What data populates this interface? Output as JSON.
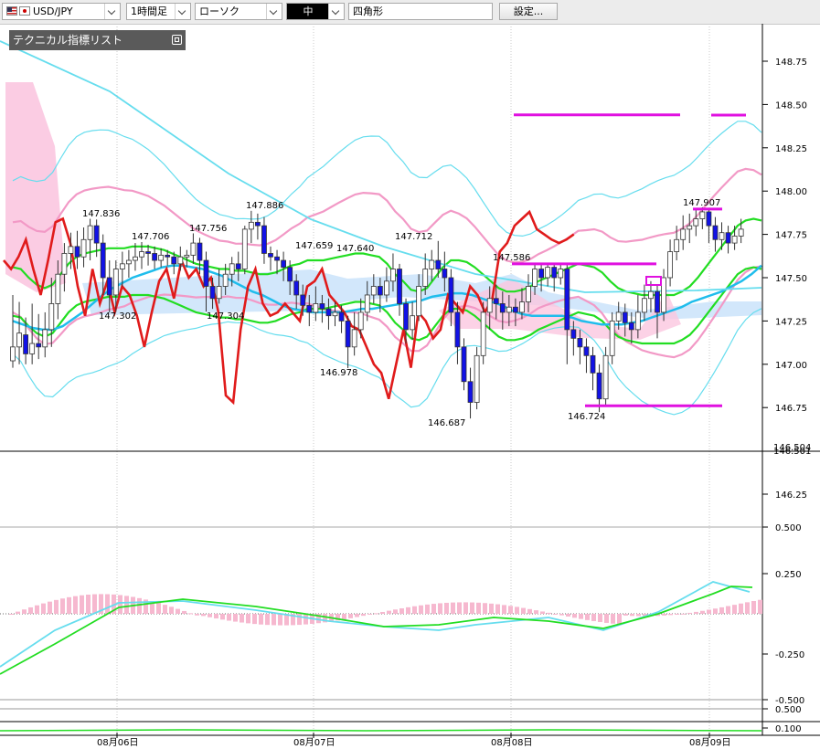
{
  "toolbar": {
    "pair": "USD/JPY",
    "timeframe": "1時間足",
    "chart_style": "ローソク",
    "line_width": "中",
    "drawing_tool": "四角形",
    "settings_label": "設定..."
  },
  "indicator_panel": {
    "title": "テクニカル指標リスト"
  },
  "colors": {
    "bull": "#ffffff",
    "bear": "#1212e6",
    "bollinger_outer": "#66ddee",
    "bollinger_inner": "#f299c6",
    "bollinger_mid": "#22dd22",
    "ma_cyan": "#1fbdec",
    "lagging_span": "#e01b1b",
    "cloud_pink": "#fbc7e0",
    "cloud_blue": "#cde4fb",
    "horizontal_lines": "#e010e0",
    "macd_hist": "#f6b8cf"
  },
  "chart_data": {
    "type": "candlestick",
    "pair": "USD/JPY",
    "timeframe": "1時間足",
    "price_axis": {
      "min": 146.14,
      "max": 148.8,
      "ticks": [
        "148.75",
        "148.50",
        "148.25",
        "148.00",
        "147.75",
        "147.50",
        "147.25",
        "147.00",
        "146.75",
        "146.25"
      ],
      "current_price_label": "146.504",
      "current_price_label_2": "146.501"
    },
    "x_axis_labels": [
      "08月06日",
      "08月07日",
      "08月08日",
      "08月09日"
    ],
    "annotations": [
      "147.836",
      "147.706",
      "147.756",
      "147.886",
      "147.659",
      "147.640",
      "147.712",
      "147.586",
      "147.907",
      "147.302",
      "147.304",
      "146.978",
      "146.687",
      "146.724"
    ],
    "candles": [
      [
        147.02,
        147.1,
        147.4,
        146.98
      ],
      [
        147.1,
        147.18,
        147.36,
        147.0
      ],
      [
        147.17,
        147.06,
        147.27,
        147.0
      ],
      [
        147.06,
        147.12,
        147.35,
        147.0
      ],
      [
        147.12,
        147.1,
        147.29,
        147.03
      ],
      [
        147.1,
        147.2,
        147.3,
        147.04
      ],
      [
        147.2,
        147.35,
        147.5,
        147.1
      ],
      [
        147.35,
        147.52,
        147.6,
        147.26
      ],
      [
        147.52,
        147.64,
        147.7,
        147.42
      ],
      [
        147.64,
        147.68,
        147.76,
        147.55
      ],
      [
        147.68,
        147.62,
        147.77,
        147.55
      ],
      [
        147.62,
        147.72,
        147.79,
        147.56
      ],
      [
        147.72,
        147.8,
        147.84,
        147.6
      ],
      [
        147.8,
        147.7,
        147.836,
        147.62
      ],
      [
        147.7,
        147.5,
        147.75,
        147.4
      ],
      [
        147.5,
        147.4,
        147.6,
        147.3
      ],
      [
        147.4,
        147.55,
        147.6,
        147.302
      ],
      [
        147.55,
        147.58,
        147.65,
        147.45
      ],
      [
        147.58,
        147.6,
        147.66,
        147.5
      ],
      [
        147.6,
        147.62,
        147.7,
        147.54
      ],
      [
        147.62,
        147.65,
        147.706,
        147.55
      ],
      [
        147.65,
        147.64,
        147.69,
        147.57
      ],
      [
        147.64,
        147.6,
        147.68,
        147.55
      ],
      [
        147.6,
        147.63,
        147.67,
        147.56
      ],
      [
        147.63,
        147.62,
        147.66,
        147.57
      ],
      [
        147.62,
        147.58,
        147.65,
        147.52
      ],
      [
        147.58,
        147.62,
        147.68,
        147.54
      ],
      [
        147.62,
        147.63,
        147.66,
        147.56
      ],
      [
        147.63,
        147.7,
        147.756,
        147.58
      ],
      [
        147.7,
        147.6,
        147.73,
        147.52
      ],
      [
        147.6,
        147.45,
        147.65,
        147.304
      ],
      [
        147.45,
        147.38,
        147.5,
        147.32
      ],
      [
        147.38,
        147.45,
        147.55,
        147.35
      ],
      [
        147.45,
        147.52,
        147.58,
        147.4
      ],
      [
        147.52,
        147.58,
        147.62,
        147.45
      ],
      [
        147.58,
        147.55,
        147.65,
        147.48
      ],
      [
        147.55,
        147.78,
        147.8,
        147.52
      ],
      [
        147.78,
        147.82,
        147.886,
        147.7
      ],
      [
        147.82,
        147.8,
        147.87,
        147.72
      ],
      [
        147.8,
        147.64,
        147.85,
        147.58
      ],
      [
        147.64,
        147.62,
        147.68,
        147.54
      ],
      [
        147.62,
        147.6,
        147.66,
        147.52
      ],
      [
        147.6,
        147.56,
        147.65,
        147.48
      ],
      [
        147.56,
        147.48,
        147.6,
        147.4
      ],
      [
        147.48,
        147.4,
        147.52,
        147.32
      ],
      [
        147.4,
        147.34,
        147.46,
        147.28
      ],
      [
        147.34,
        147.3,
        147.4,
        147.22
      ],
      [
        147.3,
        147.35,
        147.45,
        147.25
      ],
      [
        147.35,
        147.32,
        147.4,
        147.24
      ],
      [
        147.32,
        147.28,
        147.38,
        147.2
      ],
      [
        147.28,
        147.3,
        147.36,
        147.22
      ],
      [
        147.3,
        147.25,
        147.34,
        147.18
      ],
      [
        147.25,
        147.1,
        147.28,
        146.978
      ],
      [
        147.1,
        147.2,
        147.3,
        147.05
      ],
      [
        147.2,
        147.3,
        147.38,
        147.15
      ],
      [
        147.3,
        147.4,
        147.48,
        147.25
      ],
      [
        147.4,
        147.45,
        147.52,
        147.35
      ],
      [
        147.45,
        147.4,
        147.5,
        147.3
      ],
      [
        147.4,
        147.48,
        147.56,
        147.36
      ],
      [
        147.48,
        147.55,
        147.64,
        147.42
      ],
      [
        147.55,
        147.35,
        147.58,
        147.28
      ],
      [
        147.35,
        147.2,
        147.38,
        147.12
      ],
      [
        147.2,
        147.28,
        147.36,
        147.14
      ],
      [
        147.28,
        147.45,
        147.52,
        147.25
      ],
      [
        147.45,
        147.55,
        147.64,
        147.4
      ],
      [
        147.55,
        147.6,
        147.66,
        147.48
      ],
      [
        147.6,
        147.55,
        147.712,
        147.5
      ],
      [
        147.55,
        147.5,
        147.65,
        147.42
      ],
      [
        147.5,
        147.3,
        147.55,
        147.22
      ],
      [
        147.3,
        147.1,
        147.36,
        147.0
      ],
      [
        147.1,
        146.9,
        147.15,
        146.85
      ],
      [
        146.9,
        146.78,
        146.98,
        146.687
      ],
      [
        146.78,
        147.05,
        147.1,
        146.74
      ],
      [
        147.05,
        147.3,
        147.36,
        147.0
      ],
      [
        147.3,
        147.38,
        147.45,
        147.2
      ],
      [
        147.38,
        147.35,
        147.46,
        147.26
      ],
      [
        147.35,
        147.3,
        147.42,
        147.2
      ],
      [
        147.3,
        147.33,
        147.4,
        147.22
      ],
      [
        147.33,
        147.3,
        147.38,
        147.22
      ],
      [
        147.3,
        147.36,
        147.44,
        147.26
      ],
      [
        147.36,
        147.45,
        147.52,
        147.3
      ],
      [
        147.45,
        147.55,
        147.586,
        147.4
      ],
      [
        147.55,
        147.5,
        147.58,
        147.42
      ],
      [
        147.5,
        147.56,
        147.58,
        147.45
      ],
      [
        147.56,
        147.5,
        147.58,
        147.42
      ],
      [
        147.5,
        147.55,
        147.58,
        147.46
      ],
      [
        147.55,
        147.2,
        147.58,
        147.0
      ],
      [
        147.2,
        147.15,
        147.25,
        147.05
      ],
      [
        147.15,
        147.1,
        147.2,
        147.0
      ],
      [
        147.1,
        147.05,
        147.15,
        146.95
      ],
      [
        147.05,
        146.95,
        147.1,
        146.85
      ],
      [
        146.95,
        146.8,
        147.0,
        146.724
      ],
      [
        146.8,
        147.05,
        147.1,
        146.76
      ],
      [
        147.05,
        147.25,
        147.3,
        147.0
      ],
      [
        147.25,
        147.3,
        147.36,
        147.2
      ],
      [
        147.3,
        147.24,
        147.35,
        147.16
      ],
      [
        147.24,
        147.2,
        147.3,
        147.12
      ],
      [
        147.2,
        147.3,
        147.4,
        147.15
      ],
      [
        147.3,
        147.38,
        147.46,
        147.25
      ],
      [
        147.38,
        147.42,
        147.48,
        147.3
      ],
      [
        147.42,
        147.3,
        147.46,
        147.15
      ],
      [
        147.3,
        147.5,
        147.55,
        147.25
      ],
      [
        147.5,
        147.65,
        147.72,
        147.45
      ],
      [
        147.65,
        147.72,
        147.8,
        147.6
      ],
      [
        147.72,
        147.78,
        147.86,
        147.66
      ],
      [
        147.78,
        147.8,
        147.87,
        147.7
      ],
      [
        147.8,
        147.84,
        147.89,
        147.74
      ],
      [
        147.84,
        147.88,
        147.907,
        147.78
      ],
      [
        147.88,
        147.8,
        147.9,
        147.7
      ],
      [
        147.8,
        147.72,
        147.85,
        147.65
      ],
      [
        147.72,
        147.76,
        147.82,
        147.66
      ],
      [
        147.76,
        147.7,
        147.8,
        147.64
      ],
      [
        147.7,
        147.74,
        147.8,
        147.66
      ],
      [
        147.74,
        147.78,
        147.84,
        147.7
      ]
    ],
    "bollinger_mid": [
      147.56,
      147.55,
      147.5,
      147.46,
      147.44,
      147.46,
      147.52,
      147.58,
      147.62,
      147.64,
      147.65,
      147.66,
      147.67,
      147.67,
      147.67,
      147.68,
      147.68,
      147.68,
      147.67,
      147.66,
      147.64,
      147.62,
      147.6,
      147.58,
      147.57,
      147.56,
      147.55,
      147.55,
      147.54,
      147.54,
      147.53,
      147.52,
      147.52,
      147.53,
      147.55,
      147.57,
      147.58,
      147.6,
      147.6,
      147.6,
      147.61,
      147.62,
      147.63,
      147.64,
      147.64,
      147.63,
      147.62,
      147.58,
      147.52,
      147.48,
      147.43,
      147.42,
      147.44,
      147.5,
      147.56,
      147.6,
      147.6,
      147.59,
      147.56,
      147.52,
      147.48,
      147.44,
      147.42,
      147.42,
      147.43,
      147.45,
      147.48,
      147.5,
      147.52,
      147.54,
      147.56,
      147.58,
      147.57,
      147.56,
      147.53,
      147.48,
      147.44,
      147.42,
      147.41,
      147.4,
      147.4,
      147.4,
      147.4,
      147.4,
      147.42,
      147.45,
      147.5,
      147.56,
      147.62,
      147.68,
      147.74,
      147.8,
      147.83,
      147.84,
      147.83
    ],
    "ma_cyan": [
      147.25,
      147.23,
      147.21,
      147.2,
      147.2,
      147.22,
      147.26,
      147.3,
      147.35,
      147.4,
      147.44,
      147.47,
      147.5,
      147.52,
      147.54,
      147.56,
      147.57,
      147.57,
      147.56,
      147.55,
      147.53,
      147.51,
      147.48,
      147.45,
      147.42,
      147.4,
      147.37,
      147.34,
      147.32,
      147.31,
      147.3,
      147.3,
      147.3,
      147.3,
      147.31,
      147.32,
      147.32,
      147.33,
      147.34,
      147.35,
      147.36,
      147.37,
      147.39,
      147.4,
      147.41,
      147.41,
      147.4,
      147.38,
      147.36,
      147.34,
      147.31,
      147.29,
      147.28,
      147.28,
      147.28,
      147.28,
      147.27,
      147.25,
      147.24,
      147.23,
      147.23,
      147.23,
      147.24,
      147.25,
      147.27,
      147.29,
      147.31,
      147.33,
      147.36,
      147.38,
      147.4,
      147.42,
      147.45,
      147.48,
      147.52,
      147.57
    ],
    "lagging_span": [
      147.6,
      147.55,
      147.62,
      147.72,
      147.55,
      147.4,
      147.6,
      147.82,
      147.84,
      147.7,
      147.45,
      147.28,
      147.55,
      147.35,
      147.48,
      147.3,
      147.45,
      147.4,
      147.28,
      147.1,
      147.3,
      147.48,
      147.55,
      147.38,
      147.6,
      147.5,
      147.55,
      147.45,
      147.5,
      147.3,
      146.82,
      146.78,
      147.2,
      147.45,
      147.55,
      147.35,
      147.28,
      147.3,
      147.35,
      147.3,
      147.25,
      147.45,
      147.48,
      147.55,
      147.4,
      147.35,
      147.3,
      147.22,
      147.2,
      147.1,
      147.0,
      146.95,
      146.8,
      147.0,
      147.2,
      146.98,
      147.3,
      147.25,
      147.15,
      147.2,
      147.4,
      147.35,
      147.3,
      147.45,
      147.4,
      147.3,
      147.38,
      147.65,
      147.7,
      147.8,
      147.84,
      147.88,
      147.78,
      147.75,
      147.72,
      147.7,
      147.72,
      147.75
    ],
    "horizontal_lines": [
      147.58,
      146.76,
      147.896,
      148.44
    ],
    "macd_labels": [
      "0.500",
      "0.250",
      "-0.250",
      "-0.500",
      "0.500",
      "0.100"
    ]
  }
}
